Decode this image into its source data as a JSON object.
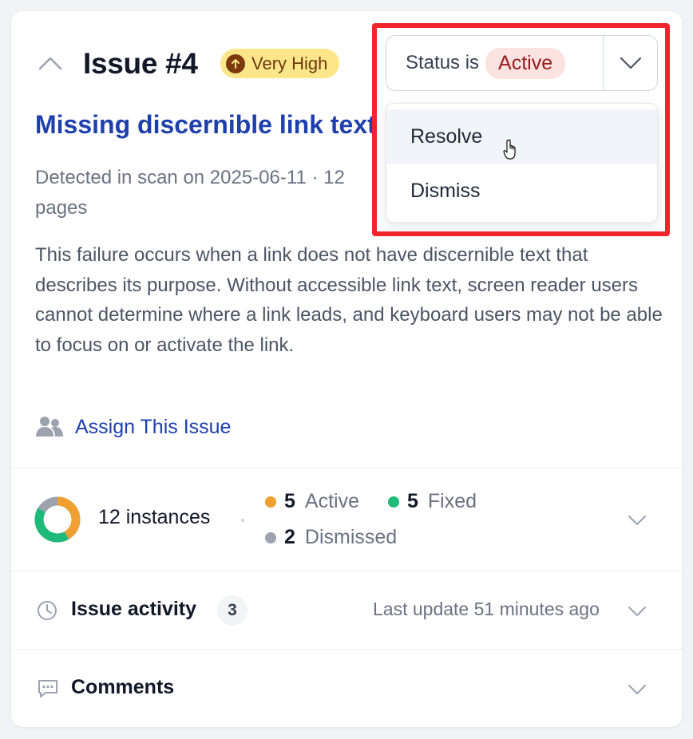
{
  "issue": {
    "title": "Issue #4",
    "severity": "Very High",
    "rule_title": "Missing discernible link text",
    "detected": "Detected in scan on 2025-06-11 · 12 pages",
    "description": "This failure occurs when a link does not have discernible text that describes its purpose. Without accessible link text, screen reader users cannot determine where a link leads, and keyboard users may not be able to focus on or activate the link.",
    "assign_label": "Assign This Issue"
  },
  "status": {
    "prefix": "Status is",
    "value": "Active",
    "menu": [
      {
        "label": "Resolve"
      },
      {
        "label": "Dismiss"
      }
    ]
  },
  "instances": {
    "label": "12 instances",
    "breakdown": [
      {
        "count": "5",
        "label": "Active",
        "color": "#f0a030"
      },
      {
        "count": "5",
        "label": "Fixed",
        "color": "#1fba7a"
      },
      {
        "count": "2",
        "label": "Dismissed",
        "color": "#9ca3af"
      }
    ]
  },
  "activity": {
    "title": "Issue activity",
    "count": "3",
    "last_update": "Last update 51 minutes ago"
  },
  "comments": {
    "title": "Comments"
  },
  "colors": {
    "link": "#1e40af",
    "highlight": "#f0242a",
    "severity_bg": "#fde68a",
    "status_bg": "#fde2e2"
  }
}
